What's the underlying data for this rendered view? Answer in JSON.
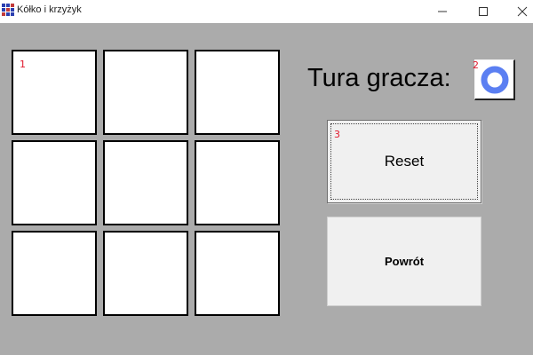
{
  "window": {
    "title": "Kółko i krzyżyk",
    "icon": "app-icon",
    "controls": {
      "minimize_icon": "minimize-icon",
      "maximize_icon": "maximize-icon",
      "close_icon": "close-icon"
    }
  },
  "board": {
    "cells": [
      {
        "label": "1",
        "value": ""
      },
      {
        "label": "",
        "value": ""
      },
      {
        "label": "",
        "value": ""
      },
      {
        "label": "",
        "value": ""
      },
      {
        "label": "",
        "value": ""
      },
      {
        "label": "",
        "value": ""
      },
      {
        "label": "",
        "value": ""
      },
      {
        "label": "",
        "value": ""
      },
      {
        "label": "",
        "value": ""
      }
    ]
  },
  "turn": {
    "label": "Tura gracza:",
    "marker_number": "2",
    "current_player": "O",
    "symbol_icon": "circle-o-icon",
    "symbol_color": "#5b7ff2"
  },
  "buttons": {
    "reset": {
      "label": "Reset",
      "marker_number": "3"
    },
    "back": {
      "label": "Powrót"
    }
  },
  "colors": {
    "background": "#ababab",
    "marker": "#e0182c",
    "button_face": "#f0f0f0"
  }
}
